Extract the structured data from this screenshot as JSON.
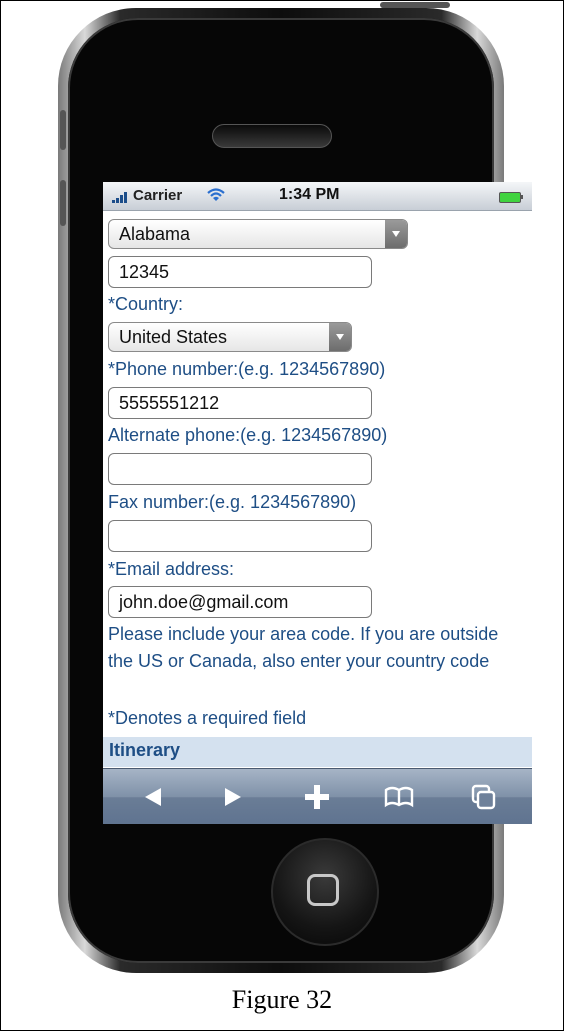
{
  "caption": "Figure 32",
  "status_bar": {
    "carrier": "Carrier",
    "time": "1:34 PM"
  },
  "form": {
    "state_select": "Alabama",
    "zip_value": "12345",
    "country_label": "*Country:",
    "country_select": "United States",
    "phone_label": "*Phone number:(e.g. 1234567890)",
    "phone_value": "5555551212",
    "alt_phone_label": "Alternate phone:(e.g. 1234567890)",
    "alt_phone_value": "",
    "fax_label": "Fax number:(e.g. 1234567890)",
    "fax_value": "",
    "email_label": "*Email address:",
    "email_value": "john.doe@gmail.com",
    "note": "Please include your area code. If you are outside the US or Canada, also enter your country code",
    "required_note": "*Denotes a required field",
    "section_header": "Itinerary"
  },
  "toolbar": {
    "icons": [
      "back-icon",
      "forward-icon",
      "add-icon",
      "bookmarks-icon",
      "pages-icon"
    ]
  },
  "colors": {
    "label": "#1e4e85",
    "section_bg": "#d4e1ef",
    "toolbar": "#7f91a8"
  }
}
